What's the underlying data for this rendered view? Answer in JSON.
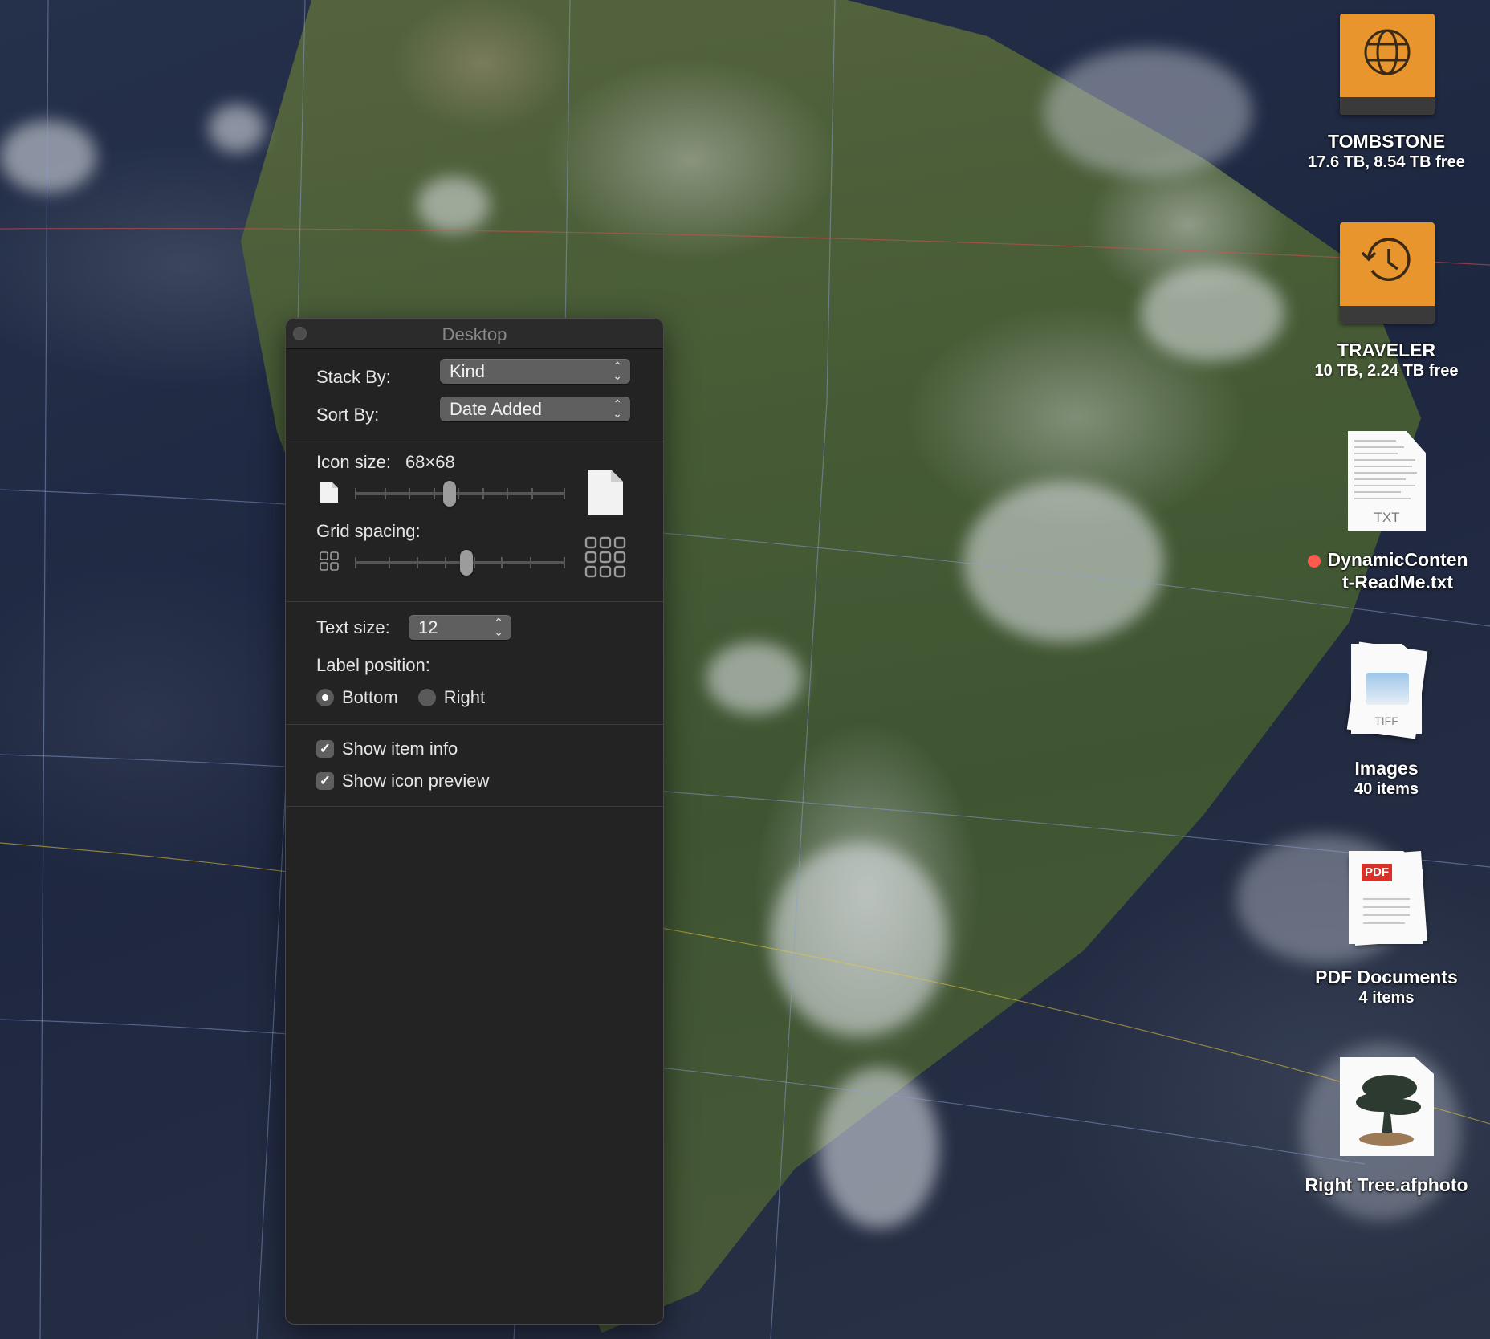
{
  "panel": {
    "title": "Desktop",
    "stack_by": {
      "label": "Stack By:",
      "value": "Kind"
    },
    "sort_by": {
      "label": "Sort By:",
      "value": "Date Added"
    },
    "icon_size": {
      "label": "Icon size:",
      "value": "68×68",
      "level": 0.45
    },
    "grid_spacing": {
      "label": "Grid spacing:",
      "level": 0.53
    },
    "text_size": {
      "label": "Text size:",
      "value": "12"
    },
    "label_position": {
      "label": "Label position:",
      "options": [
        "Bottom",
        "Right"
      ],
      "selected": "Bottom"
    },
    "show_item_info": {
      "label": "Show item info",
      "checked": true
    },
    "show_icon_preview": {
      "label": "Show icon preview",
      "checked": true
    }
  },
  "desktop_icons": [
    {
      "name": "TOMBSTONE",
      "info": "17.6 TB, 8.54 TB free",
      "icon": "globe-drive-icon"
    },
    {
      "name": "TRAVELER",
      "info": "10 TB, 2.24 TB free",
      "icon": "time-machine-drive-icon"
    },
    {
      "name_line1": "DynamicConten",
      "name_line2": "t-ReadMe.txt",
      "badge": "TXT",
      "tag_color": "#ff5a4f",
      "icon": "text-document-icon"
    },
    {
      "name": "Images",
      "info": "40 items",
      "badge": "TIFF",
      "icon": "image-stack-icon"
    },
    {
      "name": "PDF Documents",
      "info": "4 items",
      "badge": "PDF",
      "icon": "pdf-stack-icon"
    },
    {
      "name": "Right Tree.afphoto",
      "icon": "photo-document-icon"
    }
  ],
  "colors": {
    "panel_bg": "#232323",
    "drive_orange": "#e8952e",
    "tag_red": "#ff5a4f"
  }
}
